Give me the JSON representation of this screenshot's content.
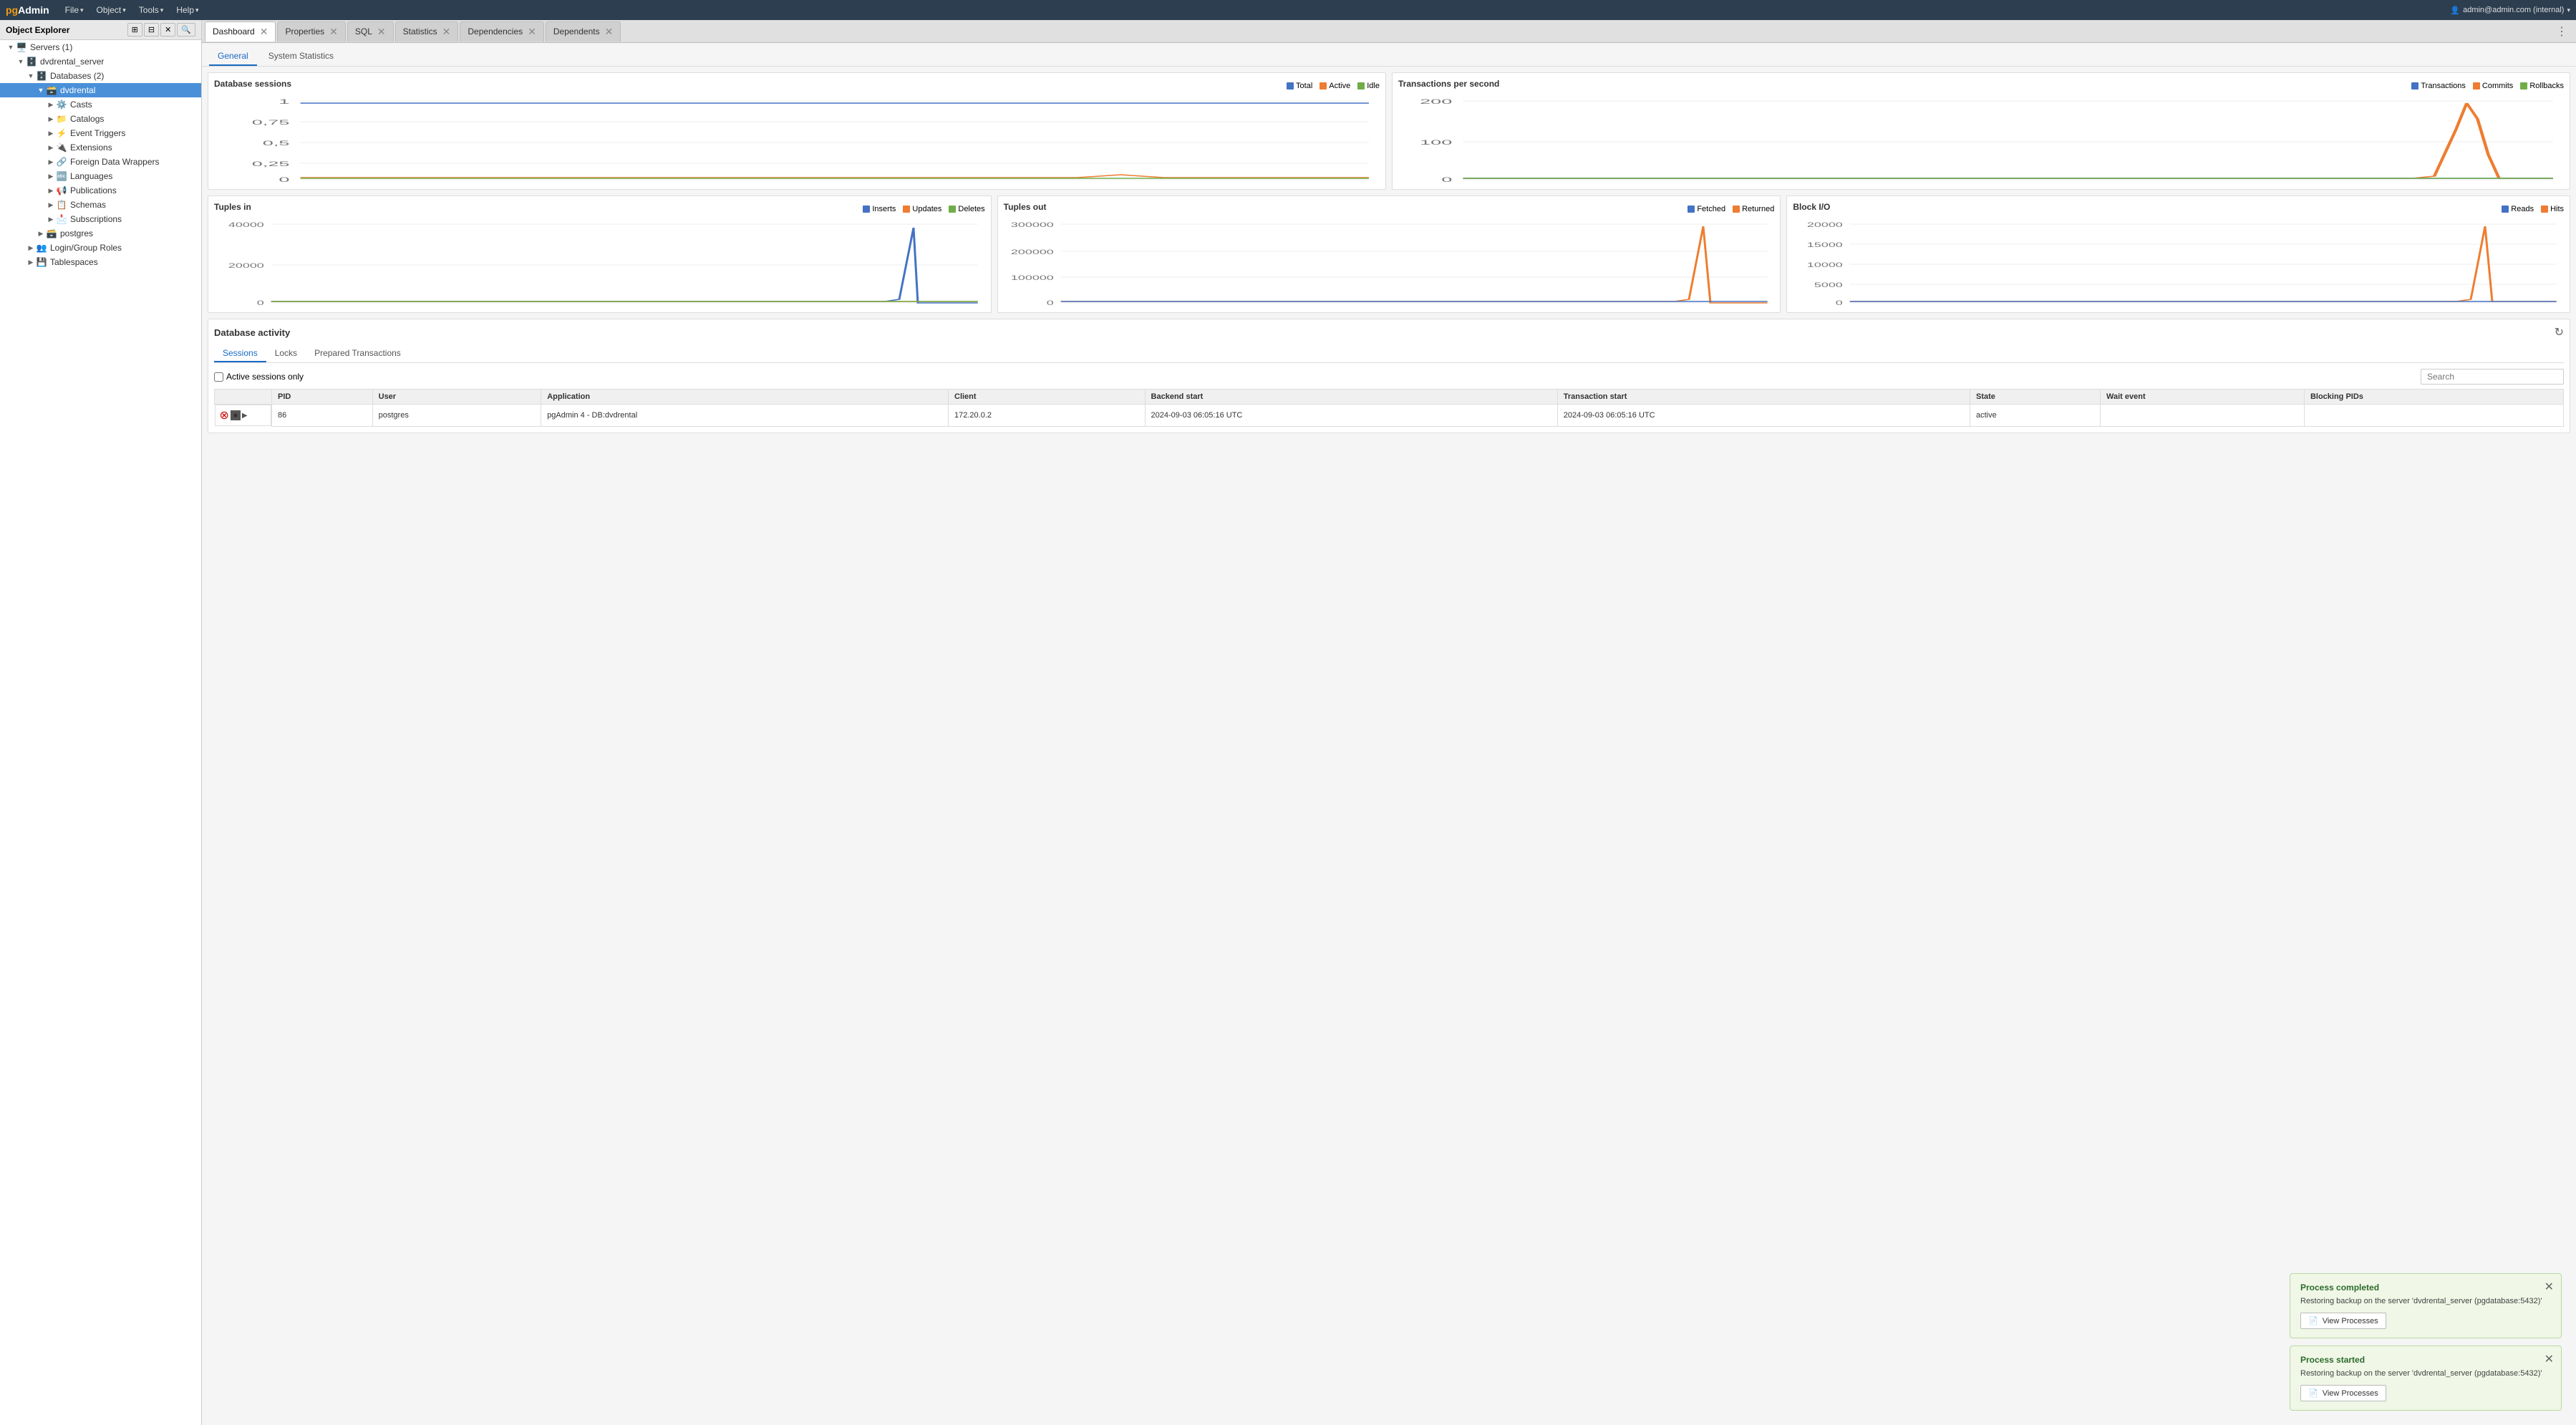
{
  "app": {
    "name": "pgAdmin",
    "name_pg": "pg",
    "name_admin": "Admin"
  },
  "menubar": {
    "items": [
      {
        "label": "File",
        "id": "file"
      },
      {
        "label": "Object",
        "id": "object"
      },
      {
        "label": "Tools",
        "id": "tools"
      },
      {
        "label": "Help",
        "id": "help"
      }
    ],
    "user": "admin@admin.com (internal)"
  },
  "sidebar": {
    "header": "Object Explorer",
    "tree": [
      {
        "id": "servers",
        "label": "Servers (1)",
        "level": 0,
        "icon": "server",
        "expanded": true,
        "chevron": "▼"
      },
      {
        "id": "dvdrental_server",
        "label": "dvdrental_server",
        "level": 1,
        "icon": "server-conn",
        "expanded": true,
        "chevron": "▼"
      },
      {
        "id": "databases",
        "label": "Databases (2)",
        "level": 2,
        "icon": "databases",
        "expanded": true,
        "chevron": "▼"
      },
      {
        "id": "dvdrental",
        "label": "dvdrental",
        "level": 3,
        "icon": "database",
        "expanded": true,
        "chevron": "▼",
        "selected": true
      },
      {
        "id": "casts",
        "label": "Casts",
        "level": 4,
        "icon": "cast",
        "expanded": false,
        "chevron": "▶"
      },
      {
        "id": "catalogs",
        "label": "Catalogs",
        "level": 4,
        "icon": "catalog",
        "expanded": false,
        "chevron": "▶"
      },
      {
        "id": "event_triggers",
        "label": "Event Triggers",
        "level": 4,
        "icon": "event-trigger",
        "expanded": false,
        "chevron": "▶"
      },
      {
        "id": "extensions",
        "label": "Extensions",
        "level": 4,
        "icon": "extension",
        "expanded": false,
        "chevron": "▶"
      },
      {
        "id": "foreign_data_wrappers",
        "label": "Foreign Data Wrappers",
        "level": 4,
        "icon": "foreign-dw",
        "expanded": false,
        "chevron": "▶"
      },
      {
        "id": "languages",
        "label": "Languages",
        "level": 4,
        "icon": "language",
        "expanded": false,
        "chevron": "▶"
      },
      {
        "id": "publications",
        "label": "Publications",
        "level": 4,
        "icon": "publication",
        "expanded": false,
        "chevron": "▶"
      },
      {
        "id": "schemas",
        "label": "Schemas",
        "level": 4,
        "icon": "schema",
        "expanded": false,
        "chevron": "▶"
      },
      {
        "id": "subscriptions",
        "label": "Subscriptions",
        "level": 4,
        "icon": "subscription",
        "expanded": false,
        "chevron": "▶"
      },
      {
        "id": "postgres",
        "label": "postgres",
        "level": 3,
        "icon": "database",
        "expanded": false,
        "chevron": "▶"
      },
      {
        "id": "login_group_roles",
        "label": "Login/Group Roles",
        "level": 2,
        "icon": "roles",
        "expanded": false,
        "chevron": "▶"
      },
      {
        "id": "tablespaces",
        "label": "Tablespaces",
        "level": 2,
        "icon": "tablespace",
        "expanded": false,
        "chevron": "▶"
      }
    ]
  },
  "tabs": [
    {
      "label": "Dashboard",
      "closable": true,
      "active": true
    },
    {
      "label": "Properties",
      "closable": true,
      "active": false
    },
    {
      "label": "SQL",
      "closable": true,
      "active": false
    },
    {
      "label": "Statistics",
      "closable": true,
      "active": false
    },
    {
      "label": "Dependencies",
      "closable": true,
      "active": false
    },
    {
      "label": "Dependents",
      "closable": true,
      "active": false
    }
  ],
  "sub_tabs": [
    {
      "label": "General",
      "active": true
    },
    {
      "label": "System Statistics",
      "active": false
    }
  ],
  "charts": {
    "db_sessions": {
      "title": "Database sessions",
      "legend": [
        {
          "label": "Total",
          "color": "#4472C4"
        },
        {
          "label": "Active",
          "color": "#ED7D31"
        },
        {
          "label": "Idle",
          "color": "#70AD47"
        }
      ],
      "y_labels": [
        "1",
        "0,75",
        "0,5",
        "0,25",
        "0"
      ],
      "values": {
        "total": 1,
        "active": 0.08,
        "idle": 0.05
      }
    },
    "transactions_per_second": {
      "title": "Transactions per second",
      "legend": [
        {
          "label": "Transactions",
          "color": "#4472C4"
        },
        {
          "label": "Commits",
          "color": "#ED7D31"
        },
        {
          "label": "Rollbacks",
          "color": "#70AD47"
        }
      ],
      "y_labels": [
        "200",
        "100",
        "0"
      ],
      "peak_value": 220
    },
    "tuples_in": {
      "title": "Tuples in",
      "legend": [
        {
          "label": "Inserts",
          "color": "#4472C4"
        },
        {
          "label": "Updates",
          "color": "#ED7D31"
        },
        {
          "label": "Deletes",
          "color": "#70AD47"
        }
      ],
      "y_labels": [
        "40000",
        "20000",
        "0"
      ],
      "peak_value": 45000
    },
    "tuples_out": {
      "title": "Tuples out",
      "legend": [
        {
          "label": "Fetched",
          "color": "#4472C4"
        },
        {
          "label": "Returned",
          "color": "#ED7D31"
        }
      ],
      "y_labels": [
        "300000",
        "200000",
        "100000",
        "0"
      ],
      "peak_value": 320000
    },
    "block_io": {
      "title": "Block I/O",
      "legend": [
        {
          "label": "Reads",
          "color": "#4472C4"
        },
        {
          "label": "Hits",
          "color": "#ED7D31"
        }
      ],
      "y_labels": [
        "20000",
        "15000",
        "10000",
        "5000",
        "0"
      ],
      "peak_value": 22000
    }
  },
  "activity": {
    "title": "Database activity",
    "tabs": [
      {
        "label": "Sessions",
        "active": true
      },
      {
        "label": "Locks",
        "active": false
      },
      {
        "label": "Prepared Transactions",
        "active": false
      }
    ],
    "active_sessions_only": "Active sessions only",
    "search_placeholder": "Search",
    "table": {
      "columns": [
        "PID",
        "User",
        "Application",
        "Client",
        "Backend start",
        "Transaction start",
        "State",
        "Wait event",
        "Blocking PIDs"
      ],
      "rows": [
        {
          "pid": "86",
          "user": "postgres",
          "application": "pgAdmin 4 - DB:dvdrental",
          "client": "172.20.0.2",
          "backend_start": "2024-09-03 06:05:16 UTC",
          "transaction_start": "2024-09-03 06:05:16 UTC",
          "state": "active",
          "wait_event": "",
          "blocking_pids": ""
        }
      ]
    }
  },
  "notifications": [
    {
      "id": "notif1",
      "title": "Process completed",
      "body": "Restoring backup on the server 'dvdrental_server (pgdatabase:5432)'",
      "button_label": "View Processes",
      "type": "completed"
    },
    {
      "id": "notif2",
      "title": "Process started",
      "body": "Restoring backup on the server 'dvdrental_server (pgdatabase:5432)'",
      "button_label": "View Processes",
      "type": "started"
    }
  ],
  "colors": {
    "blue": "#4472C4",
    "orange": "#ED7D31",
    "green": "#70AD47",
    "selected_bg": "#4a90d9",
    "notification_bg": "#f0f7e6",
    "notification_border": "#b8d9a0"
  }
}
